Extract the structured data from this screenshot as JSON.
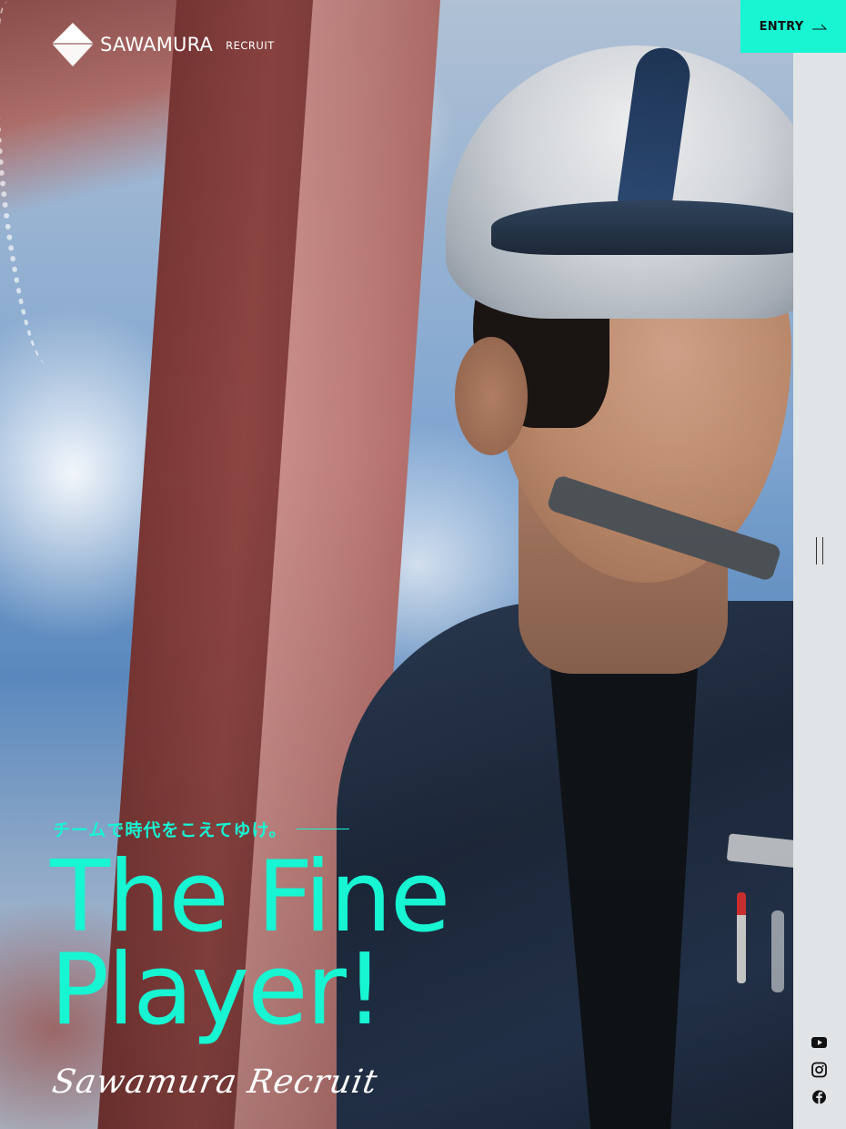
{
  "header": {
    "logo_name": "SAWAMURA",
    "logo_sub": "RECRUIT",
    "entry_label": "ENTRY"
  },
  "hero": {
    "catch_copy": "チームで時代をこえてゆけ。",
    "headline_line1": "The Fine",
    "headline_line2": "Player!",
    "signature": "Sawamura Recruit"
  },
  "social": {
    "icons": [
      "youtube-icon",
      "instagram-icon",
      "facebook-icon"
    ]
  },
  "colors": {
    "accent": "#17f5d3",
    "rail": "#e1e4e6",
    "text_dark": "#111111"
  }
}
